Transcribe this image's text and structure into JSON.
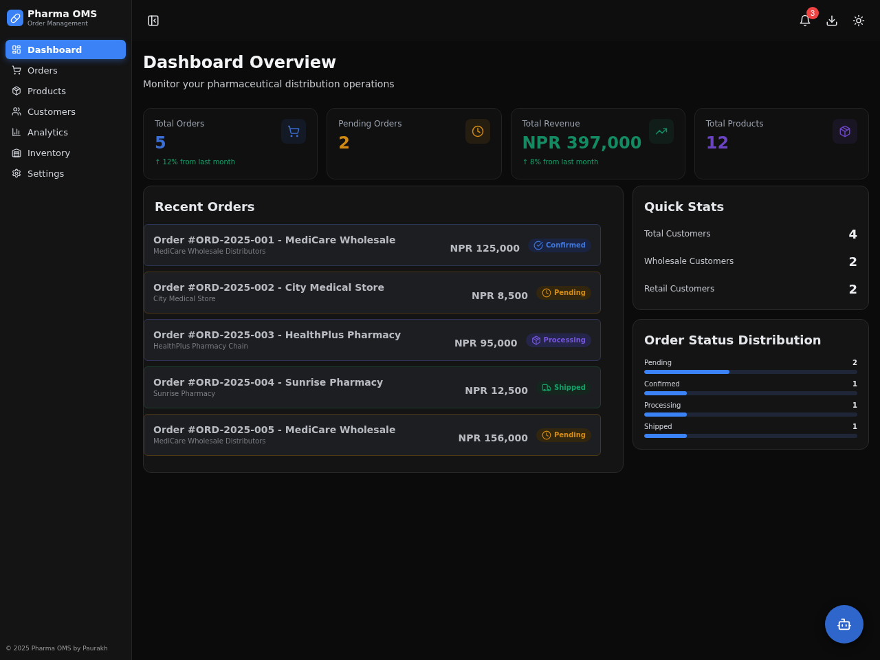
{
  "sidebar": {
    "brand": {
      "name": "Pharma OMS",
      "subtitle": "Order Management"
    },
    "items": [
      {
        "label": "Dashboard",
        "selected": true
      },
      {
        "label": "Orders",
        "selected": false
      },
      {
        "label": "Products",
        "selected": false
      },
      {
        "label": "Customers",
        "selected": false
      },
      {
        "label": "Analytics",
        "selected": false
      },
      {
        "label": "Inventory",
        "selected": false
      },
      {
        "label": "Settings",
        "selected": false
      }
    ],
    "footer": "© 2025 Pharma OMS by Paurakh"
  },
  "header": {
    "notifications": {
      "count": "3"
    }
  },
  "page": {
    "title": "Dashboard Overview",
    "subtitle": "Monitor your pharmaceutical distribution operations"
  },
  "stats": [
    {
      "label": "Total Orders",
      "value": "5",
      "trend": "↑ 12% from last month",
      "color": "#3b6fd6"
    },
    {
      "label": "Pending Orders",
      "value": "2",
      "color": "#d08a14"
    },
    {
      "label": "Total Revenue",
      "value": "NPR 397,000",
      "trend": "↑ 8% from last month",
      "color": "#138a62"
    },
    {
      "label": "Total Products",
      "value": "12",
      "color": "#6a44c2"
    }
  ],
  "recent_orders": {
    "title": "Recent Orders",
    "orders": [
      {
        "title": "Order #ORD-2025-001 - MediCare Wholesale",
        "customer": "MediCare Wholesale Distributors",
        "amount": "NPR 125,000",
        "status": {
          "label": "Confirmed",
          "kind": "confirmed"
        }
      },
      {
        "title": "Order #ORD-2025-002 - City Medical Store",
        "customer": "City Medical Store",
        "amount": "NPR 8,500",
        "status": {
          "label": "Pending",
          "kind": "pending"
        }
      },
      {
        "title": "Order #ORD-2025-003 - HealthPlus Pharmacy",
        "customer": "HealthPlus Pharmacy Chain",
        "amount": "NPR 95,000",
        "status": {
          "label": "Processing",
          "kind": "processing"
        }
      },
      {
        "title": "Order #ORD-2025-004 - Sunrise Pharmacy",
        "customer": "Sunrise Pharmacy",
        "amount": "NPR 12,500",
        "status": {
          "label": "Shipped",
          "kind": "shipped"
        }
      },
      {
        "title": "Order #ORD-2025-005 - MediCare Wholesale",
        "customer": "MediCare Wholesale Distributors",
        "amount": "NPR 156,000",
        "status": {
          "label": "Pending",
          "kind": "pending"
        }
      }
    ]
  },
  "quick_stats": {
    "title": "Quick Stats",
    "rows": [
      {
        "label": "Total Customers",
        "value": "4"
      },
      {
        "label": "Wholesale Customers",
        "value": "2"
      },
      {
        "label": "Retail Customers",
        "value": "2"
      }
    ]
  },
  "status_distribution": {
    "title": "Order Status Distribution",
    "rows": [
      {
        "label": "Pending",
        "count": "2",
        "level": 0.4
      },
      {
        "label": "Confirmed",
        "count": "1",
        "level": 0.2
      },
      {
        "label": "Processing",
        "count": "1",
        "level": 0.2
      },
      {
        "label": "Shipped",
        "count": "1",
        "level": 0.2
      }
    ]
  }
}
